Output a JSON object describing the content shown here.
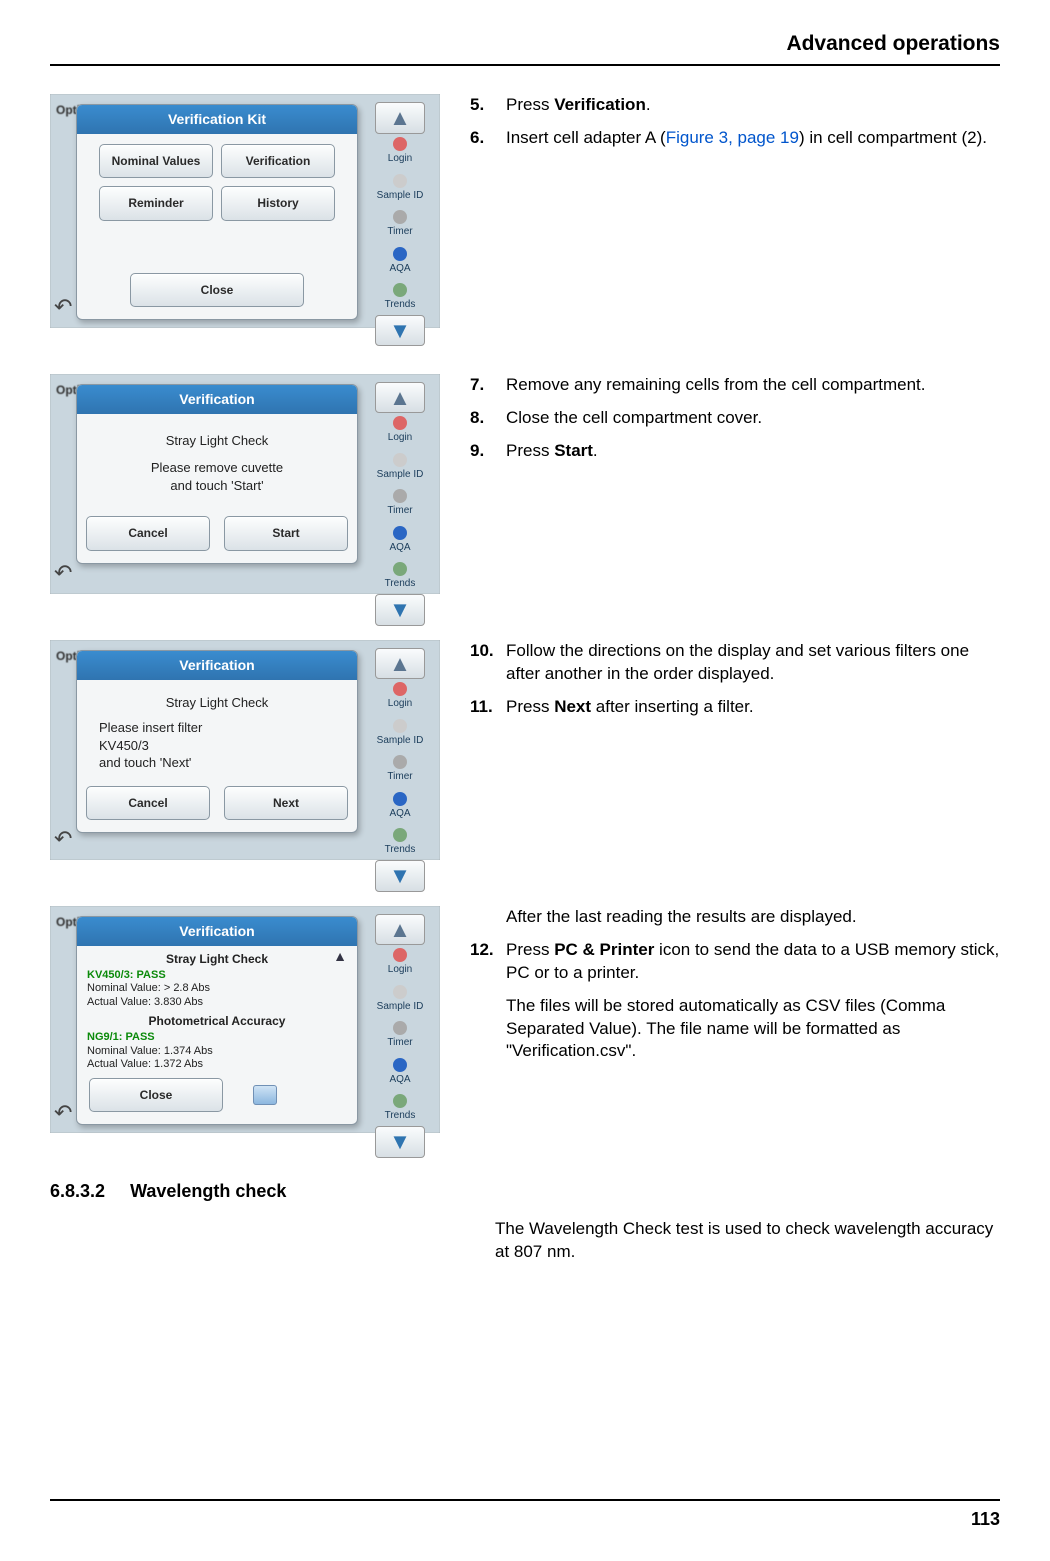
{
  "header": {
    "chapter": "Advanced operations"
  },
  "footer": {
    "page_number": "113"
  },
  "section": {
    "number": "6.8.3.2",
    "title": "Wavelength check",
    "body": "The Wavelength Check test is used to check wavelength accuracy at 807 nm."
  },
  "sidebar_icons": {
    "login": "Login",
    "sample_id": "Sample ID",
    "timer": "Timer",
    "aqa": "AQA",
    "trends": "Trends"
  },
  "screens": {
    "kit": {
      "bg_label": "Optical Checks",
      "title": "Verification Kit",
      "btn_nominal": "Nominal Values",
      "btn_verification": "Verification",
      "btn_reminder": "Reminder",
      "btn_history": "History",
      "btn_close": "Close"
    },
    "start": {
      "title": "Verification",
      "line1": "Stray Light Check",
      "line2": "Please remove cuvette",
      "line3": "and touch 'Start'",
      "btn_cancel": "Cancel",
      "btn_start": "Start"
    },
    "next": {
      "title": "Verification",
      "line1": "Stray Light Check",
      "line2": "Please insert filter",
      "line3": "KV450/3",
      "line4": "and touch 'Next'",
      "btn_cancel": "Cancel",
      "btn_next": "Next"
    },
    "results": {
      "title": "Verification",
      "hd1": "Stray Light Check",
      "pass1": "KV450/3: PASS",
      "nv1": "Nominal Value: > 2.8 Abs",
      "av1": "Actual Value:   3.830 Abs",
      "hd2": "Photometrical Accuracy",
      "pass2": "NG9/1: PASS",
      "nv2": "Nominal Value:   1.374 Abs",
      "av2": "Actual Value:   1.372 Abs",
      "btn_close": "Close"
    }
  },
  "steps": {
    "s5": {
      "num": "5.",
      "prefix": "Press ",
      "bold": "Verification",
      "suffix": "."
    },
    "s6": {
      "num": "6.",
      "prefix": "Insert cell adapter A (",
      "xref": "Figure 3, page 19",
      "suffix": ") in cell compartment (2)."
    },
    "s7": {
      "num": "7.",
      "text": "Remove any remaining cells from the cell compartment."
    },
    "s8": {
      "num": "8.",
      "text": "Close the cell compartment cover."
    },
    "s9": {
      "num": "9.",
      "prefix": "Press ",
      "bold": "Start",
      "suffix": "."
    },
    "s10": {
      "num": "10.",
      "text": "Follow the directions on the display and set various filters one after another in the order displayed."
    },
    "s11": {
      "num": "11.",
      "prefix": "Press ",
      "bold": "Next",
      "suffix": " after inserting a filter."
    },
    "s12_intro": "After the last reading the results are displayed.",
    "s12": {
      "num": "12.",
      "prefix": "Press ",
      "bold": "PC & Printer",
      "suffix": " icon to send the data to a USB memory stick, PC or to a printer."
    },
    "s12_extra": "The files will be stored automatically as CSV files (Comma Separated Value). The file name will be formatted as \"Verification.csv\"."
  }
}
